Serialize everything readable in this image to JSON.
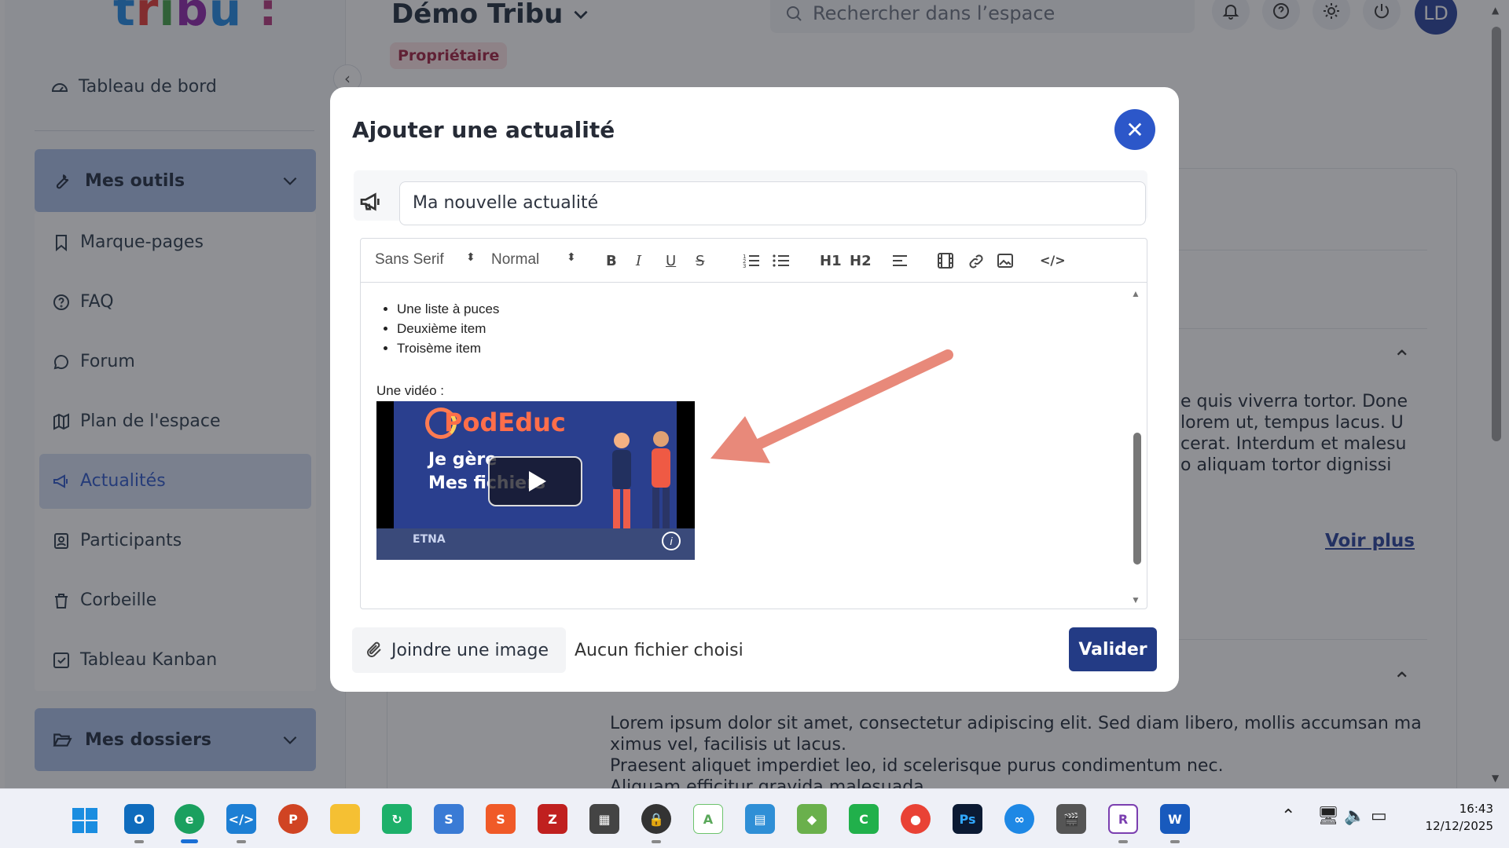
{
  "sidebar": {
    "dashboard": "Tableau de bord",
    "tools_group": "Mes outils",
    "items": [
      {
        "label": "Marque-pages"
      },
      {
        "label": "FAQ"
      },
      {
        "label": "Forum"
      },
      {
        "label": "Plan de l'espace"
      },
      {
        "label": "Actualités"
      },
      {
        "label": "Participants"
      },
      {
        "label": "Corbeille"
      },
      {
        "label": "Tableau Kanban"
      }
    ],
    "folders_group": "Mes dossiers"
  },
  "header": {
    "space_title": "Démo Tribu",
    "role_badge": "Propriétaire",
    "search_placeholder": "Rechercher dans l’espace",
    "avatar_initials": "LD"
  },
  "background": {
    "para1": [
      "e quis viverra tortor. Done",
      "lorem ut, tempus lacus. U",
      "cerat. Interdum et malesu",
      "o aliquam tortor dignissi"
    ],
    "voir_plus": "Voir plus",
    "para2": [
      "Lorem ipsum dolor sit amet, consectetur adipiscing elit. Sed diam libero, mollis accumsan ma",
      "ximus vel, facilisis ut lacus.",
      "Praesent aliquet imperdiet leo, id scelerisque purus condimentum nec.",
      "Aliquam efficitur gravida malesuada"
    ]
  },
  "modal": {
    "title": "Ajouter une actualité",
    "title_value": "Ma nouvelle actualité",
    "toolbar": {
      "font": "Sans Serif",
      "size": "Normal",
      "bold": "B",
      "italic": "I",
      "underline": "U",
      "strike": "S",
      "h1": "H1",
      "h2": "H2",
      "code": "</>"
    },
    "editor": {
      "bullets": [
        "Une liste à puces",
        "Deuxième item",
        "Troisème item"
      ],
      "video_label": "Une vidéo :",
      "video": {
        "brand": "PodEduc",
        "line1": "Je gère",
        "line2": "Mes fichiers",
        "footer": "ETNA"
      }
    },
    "attach_label": "Joindre une image",
    "no_file": "Aucun fichier choisi",
    "submit": "Valider"
  },
  "taskbar": {
    "time": "16:43",
    "date": "12/12/2025"
  },
  "colors": {
    "primary": "#233b85",
    "close_button": "#2c57c9",
    "arrow": "#e8897a"
  }
}
